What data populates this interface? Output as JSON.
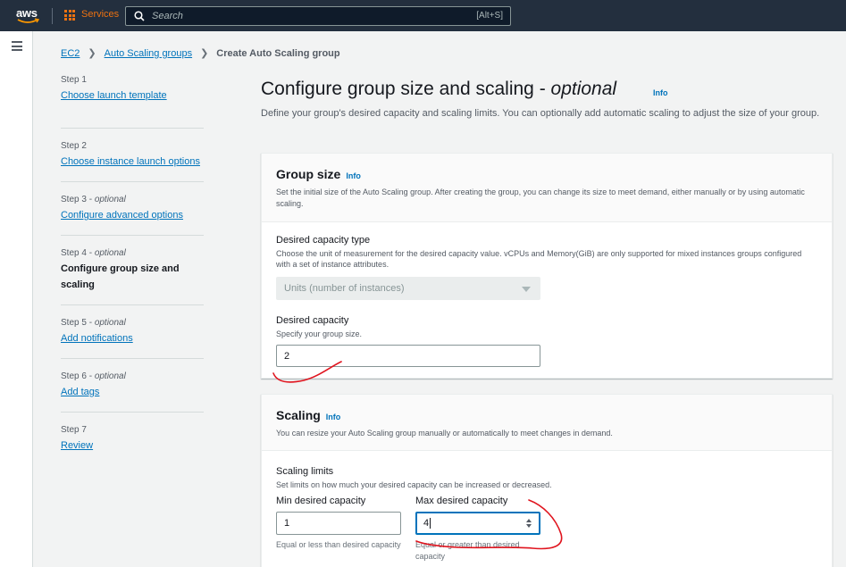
{
  "topbar": {
    "logo_text": "aws",
    "services_label": "Services",
    "search_placeholder": "Search",
    "search_shortcut": "[Alt+S]"
  },
  "breadcrumb": {
    "items": [
      "EC2",
      "Auto Scaling groups"
    ],
    "current": "Create Auto Scaling group"
  },
  "steps": [
    {
      "num": "Step 1",
      "optional": "",
      "label": "Choose launch template",
      "state": "link"
    },
    {
      "num": "Step 2",
      "optional": "",
      "label": "Choose instance launch options",
      "state": "link"
    },
    {
      "num": "Step 3",
      "optional": "optional",
      "label": "Configure advanced options",
      "state": "link"
    },
    {
      "num": "Step 4",
      "optional": "optional",
      "label": "Configure group size and scaling",
      "state": "current"
    },
    {
      "num": "Step 5",
      "optional": "optional",
      "label": "Add notifications",
      "state": "link"
    },
    {
      "num": "Step 6",
      "optional": "optional",
      "label": "Add tags",
      "state": "link"
    },
    {
      "num": "Step 7",
      "optional": "",
      "label": "Review",
      "state": "link"
    }
  ],
  "page": {
    "title": "Configure group size and scaling - ",
    "title_optional": "optional",
    "info": "Info",
    "description": "Define your group's desired capacity and scaling limits. You can optionally add automatic scaling to adjust the size of your group."
  },
  "group_size": {
    "title": "Group size",
    "info": "Info",
    "subtitle": "Set the initial size of the Auto Scaling group. After creating the group, you can change its size to meet demand, either manually or by using automatic scaling.",
    "capacity_type_label": "Desired capacity type",
    "capacity_type_hint": "Choose the unit of measurement for the desired capacity value. vCPUs and Memory(GiB) are only supported for mixed instances groups configured with a set of instance attributes.",
    "capacity_type_value": "Units (number of instances)",
    "desired_label": "Desired capacity",
    "desired_hint": "Specify your group size.",
    "desired_value": "2"
  },
  "scaling": {
    "title": "Scaling",
    "info": "Info",
    "subtitle": "You can resize your Auto Scaling group manually or automatically to meet changes in demand.",
    "limits_label": "Scaling limits",
    "limits_hint": "Set limits on how much your desired capacity can be increased or decreased.",
    "min_label": "Min desired capacity",
    "min_value": "1",
    "min_constraint": "Equal or less than desired capacity",
    "max_label": "Max desired capacity",
    "max_value": "4",
    "max_constraint": "Equal or greater than desired capacity"
  },
  "colors": {
    "topbar": "#232f3e",
    "accent_orange": "#ec7211",
    "link_blue": "#0073bb",
    "annotation_red": "#e0141e"
  }
}
